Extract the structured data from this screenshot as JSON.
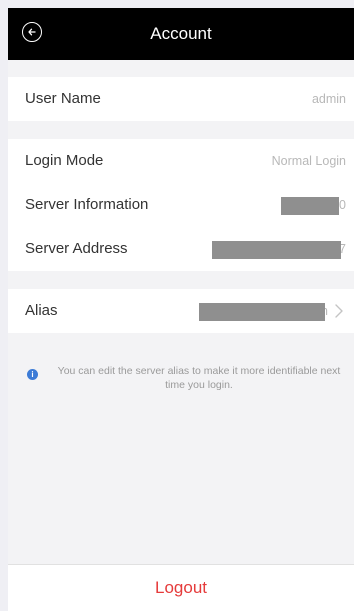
{
  "header": {
    "title": "Account",
    "back_icon": "back-arrow-circle-icon"
  },
  "rows": {
    "user_name": {
      "label": "User Name",
      "value": "admin"
    },
    "login_mode": {
      "label": "Login Mode",
      "value": "Normal Login"
    },
    "server_information": {
      "label": "Server Information",
      "visible_tail": "0"
    },
    "server_address": {
      "label": "Server Address",
      "visible_tail": "7"
    },
    "alias": {
      "label": "Alias",
      "visible_tail": "n"
    }
  },
  "info": {
    "icon": "info-icon",
    "glyph": "i",
    "text": "You can edit the server alias to make it more identifiable next time you login."
  },
  "logout": {
    "label": "Logout"
  },
  "colors": {
    "logout": "#e53b3b",
    "info": "#3c7bd6",
    "header": "#000000"
  }
}
